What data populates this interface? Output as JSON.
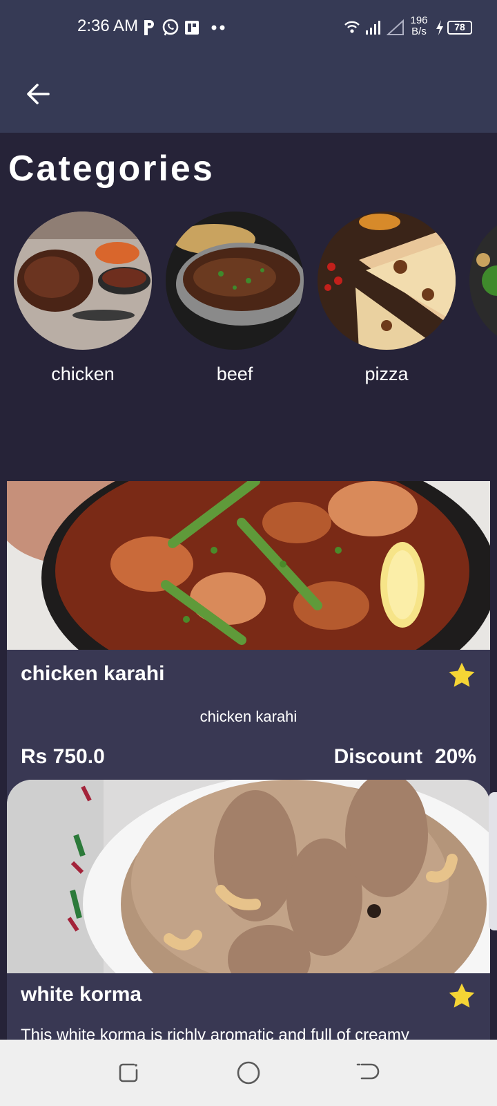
{
  "status_bar": {
    "time": "2:36 AM",
    "net_speed_value": "196",
    "net_speed_unit": "B/s",
    "battery": "78"
  },
  "app_bar": {
    "back_icon": "arrow-left-icon"
  },
  "categories": {
    "title": "Categories",
    "items": [
      {
        "label": "chicken"
      },
      {
        "label": "beef"
      },
      {
        "label": "pizza"
      }
    ]
  },
  "dishes": [
    {
      "name": "chicken karahi",
      "description": "chicken karahi",
      "price": "Rs 750.0",
      "discount_label": "Discount",
      "discount_value": "20%",
      "favorite_icon": "star-icon"
    },
    {
      "name": "white korma",
      "description": "This white korma is richly aromatic and full of creamy",
      "favorite_icon": "star-icon"
    }
  ],
  "colors": {
    "background": "#262338",
    "app_bar": "#363a55",
    "card": "#393853",
    "star": "#f5d535",
    "nav_bar": "#efefef"
  }
}
